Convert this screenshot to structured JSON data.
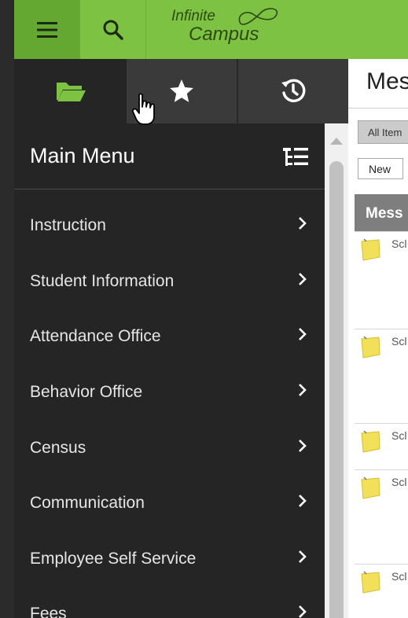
{
  "header": {
    "logo_line1": "Infinite",
    "logo_line2": "Campus",
    "menu_icon": "hamburger-icon",
    "search_icon": "search-icon",
    "brand_color": "#7dc242"
  },
  "sidebar": {
    "tabs": [
      {
        "icon": "folder-open-icon",
        "active": true
      },
      {
        "icon": "star-icon",
        "active": false
      },
      {
        "icon": "history-icon",
        "active": false
      }
    ],
    "title": "Main Menu",
    "items": [
      {
        "label": "Instruction"
      },
      {
        "label": "Student Information"
      },
      {
        "label": "Attendance Office"
      },
      {
        "label": "Behavior Office"
      },
      {
        "label": "Census"
      },
      {
        "label": "Communication"
      },
      {
        "label": "Employee Self Service"
      },
      {
        "label": "Fees"
      }
    ]
  },
  "content": {
    "title": "Mes",
    "filter_label": "All Item",
    "new_label": "New",
    "table_header": "Mess",
    "rows": [
      {
        "text": "Scl"
      },
      {
        "text": "Scl"
      },
      {
        "text": "Scl"
      },
      {
        "text": "Scl"
      },
      {
        "text": "Scl"
      }
    ]
  }
}
